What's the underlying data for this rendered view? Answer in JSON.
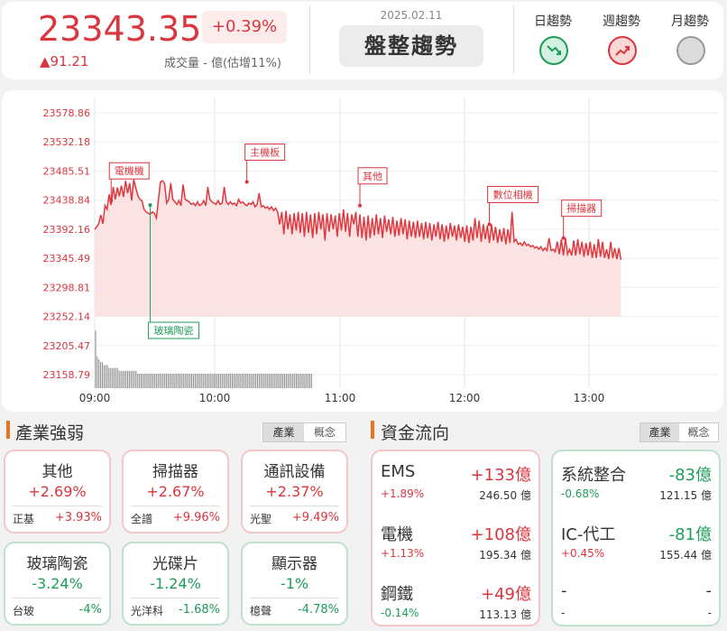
{
  "index": {
    "value": "23343.35",
    "change_pct": "+0.39%",
    "change": "▲91.21",
    "volume": "成交量 - 億(估增11%)",
    "date": "2025.02.11",
    "trend": "盤整趨勢"
  },
  "trends": [
    {
      "label": "日趨勢",
      "status": "down",
      "color": "#1e9c5a",
      "icon": "trend-down-icon"
    },
    {
      "label": "週趨勢",
      "status": "up",
      "color": "#d9363e",
      "icon": "trend-up-icon"
    },
    {
      "label": "月趨勢",
      "status": "neutral",
      "color": "#999999",
      "icon": "neutral-circle-icon"
    }
  ],
  "chart_data": {
    "type": "line",
    "y_ticks": [
      "23578.86",
      "23532.18",
      "23485.51",
      "23438.84",
      "23392.16",
      "23345.49",
      "23298.81",
      "23252.14",
      "23205.47",
      "23158.79"
    ],
    "x_ticks": [
      "09:00",
      "10:00",
      "11:00",
      "12:00",
      "13:00"
    ],
    "ylim": [
      23158.79,
      23578.86
    ],
    "xlim": [
      0,
      270
    ],
    "price": [
      [
        0,
        23392
      ],
      [
        1,
        23396
      ],
      [
        2,
        23402
      ],
      [
        3,
        23415
      ],
      [
        4,
        23401
      ],
      [
        5,
        23430
      ],
      [
        6,
        23424
      ],
      [
        7,
        23448
      ],
      [
        8,
        23431
      ],
      [
        9,
        23460
      ],
      [
        10,
        23440
      ],
      [
        11,
        23459
      ],
      [
        12,
        23445
      ],
      [
        13,
        23462
      ],
      [
        14,
        23444
      ],
      [
        15,
        23470
      ],
      [
        16,
        23450
      ],
      [
        17,
        23466
      ],
      [
        18,
        23438
      ],
      [
        19,
        23472
      ],
      [
        20,
        23458
      ],
      [
        21,
        23446
      ],
      [
        22,
        23440
      ],
      [
        23,
        23438
      ],
      [
        24,
        23424
      ],
      [
        25,
        23420
      ],
      [
        26,
        23418
      ],
      [
        27,
        23416
      ],
      [
        28,
        23420
      ],
      [
        29,
        23418
      ],
      [
        30,
        23410
      ],
      [
        31,
        23440
      ],
      [
        32,
        23468
      ],
      [
        33,
        23470
      ],
      [
        34,
        23465
      ],
      [
        35,
        23434
      ],
      [
        36,
        23440
      ],
      [
        37,
        23466
      ],
      [
        38,
        23440
      ],
      [
        39,
        23436
      ],
      [
        40,
        23432
      ],
      [
        41,
        23438
      ],
      [
        42,
        23430
      ],
      [
        43,
        23464
      ],
      [
        44,
        23440
      ],
      [
        45,
        23438
      ],
      [
        46,
        23436
      ],
      [
        47,
        23432
      ],
      [
        48,
        23434
      ],
      [
        49,
        23430
      ],
      [
        50,
        23436
      ],
      [
        51,
        23430
      ],
      [
        52,
        23432
      ],
      [
        53,
        23438
      ],
      [
        54,
        23430
      ],
      [
        55,
        23460
      ],
      [
        56,
        23440
      ],
      [
        57,
        23436
      ],
      [
        58,
        23434
      ],
      [
        59,
        23432
      ],
      [
        60,
        23438
      ],
      [
        61,
        23432
      ],
      [
        62,
        23434
      ],
      [
        63,
        23460
      ],
      [
        64,
        23436
      ],
      [
        65,
        23432
      ],
      [
        66,
        23436
      ],
      [
        67,
        23432
      ],
      [
        68,
        23434
      ],
      [
        69,
        23430
      ],
      [
        70,
        23440
      ],
      [
        71,
        23434
      ],
      [
        72,
        23436
      ],
      [
        73,
        23432
      ],
      [
        74,
        23430
      ],
      [
        75,
        23434
      ],
      [
        76,
        23432
      ],
      [
        77,
        23436
      ],
      [
        78,
        23428
      ],
      [
        79,
        23432
      ],
      [
        80,
        23450
      ],
      [
        81,
        23428
      ],
      [
        82,
        23430
      ],
      [
        83,
        23426
      ],
      [
        84,
        23428
      ],
      [
        85,
        23424
      ],
      [
        86,
        23428
      ],
      [
        87,
        23422
      ],
      [
        88,
        23426
      ],
      [
        89,
        23420
      ],
      [
        90,
        23400
      ],
      [
        91,
        23420
      ],
      [
        92,
        23384
      ],
      [
        93,
        23422
      ],
      [
        94,
        23392
      ],
      [
        95,
        23416
      ],
      [
        96,
        23384
      ],
      [
        97,
        23418
      ],
      [
        98,
        23390
      ],
      [
        99,
        23420
      ],
      [
        100,
        23386
      ],
      [
        101,
        23418
      ],
      [
        102,
        23380
      ],
      [
        103,
        23420
      ],
      [
        104,
        23386
      ],
      [
        105,
        23416
      ],
      [
        106,
        23378
      ],
      [
        107,
        23418
      ],
      [
        108,
        23384
      ],
      [
        109,
        23420
      ],
      [
        110,
        23392
      ],
      [
        111,
        23416
      ],
      [
        112,
        23374
      ],
      [
        113,
        23418
      ],
      [
        114,
        23388
      ],
      [
        115,
        23416
      ],
      [
        116,
        23392
      ],
      [
        117,
        23414
      ],
      [
        118,
        23380
      ],
      [
        119,
        23418
      ],
      [
        120,
        23390
      ],
      [
        121,
        23424
      ],
      [
        122,
        23388
      ],
      [
        123,
        23418
      ],
      [
        124,
        23380
      ],
      [
        125,
        23416
      ],
      [
        126,
        23400
      ],
      [
        127,
        23420
      ],
      [
        128,
        23380
      ],
      [
        129,
        23416
      ],
      [
        130,
        23378
      ],
      [
        131,
        23412
      ],
      [
        132,
        23374
      ],
      [
        133,
        23414
      ],
      [
        134,
        23378
      ],
      [
        135,
        23410
      ],
      [
        136,
        23382
      ],
      [
        137,
        23416
      ],
      [
        138,
        23384
      ],
      [
        139,
        23410
      ],
      [
        140,
        23378
      ],
      [
        141,
        23414
      ],
      [
        142,
        23388
      ],
      [
        143,
        23408
      ],
      [
        144,
        23384
      ],
      [
        145,
        23412
      ],
      [
        146,
        23380
      ],
      [
        147,
        23406
      ],
      [
        148,
        23382
      ],
      [
        149,
        23410
      ],
      [
        150,
        23384
      ],
      [
        151,
        23408
      ],
      [
        152,
        23376
      ],
      [
        153,
        23406
      ],
      [
        154,
        23380
      ],
      [
        155,
        23404
      ],
      [
        156,
        23378
      ],
      [
        157,
        23406
      ],
      [
        158,
        23380
      ],
      [
        159,
        23402
      ],
      [
        160,
        23376
      ],
      [
        161,
        23404
      ],
      [
        162,
        23378
      ],
      [
        163,
        23402
      ],
      [
        164,
        23374
      ],
      [
        165,
        23400
      ],
      [
        166,
        23380
      ],
      [
        167,
        23404
      ],
      [
        168,
        23376
      ],
      [
        169,
        23400
      ],
      [
        170,
        23372
      ],
      [
        171,
        23398
      ],
      [
        172,
        23376
      ],
      [
        173,
        23402
      ],
      [
        174,
        23380
      ],
      [
        175,
        23398
      ],
      [
        176,
        23374
      ],
      [
        177,
        23400
      ],
      [
        178,
        23378
      ],
      [
        179,
        23396
      ],
      [
        180,
        23372
      ],
      [
        181,
        23398
      ],
      [
        182,
        23370
      ],
      [
        183,
        23396
      ],
      [
        184,
        23374
      ],
      [
        185,
        23410
      ],
      [
        186,
        23378
      ],
      [
        187,
        23406
      ],
      [
        188,
        23372
      ],
      [
        189,
        23400
      ],
      [
        190,
        23376
      ],
      [
        191,
        23398
      ],
      [
        192,
        23370
      ],
      [
        193,
        23400
      ],
      [
        194,
        23374
      ],
      [
        195,
        23396
      ],
      [
        196,
        23370
      ],
      [
        197,
        23392
      ],
      [
        198,
        23372
      ],
      [
        199,
        23394
      ],
      [
        200,
        23368
      ],
      [
        201,
        23392
      ],
      [
        202,
        23370
      ],
      [
        203,
        23420
      ],
      [
        204,
        23372
      ],
      [
        205,
        23376
      ],
      [
        206,
        23368
      ],
      [
        207,
        23370
      ],
      [
        208,
        23366
      ],
      [
        209,
        23372
      ],
      [
        210,
        23366
      ],
      [
        211,
        23368
      ],
      [
        212,
        23364
      ],
      [
        213,
        23366
      ],
      [
        214,
        23362
      ],
      [
        215,
        23364
      ],
      [
        216,
        23360
      ],
      [
        217,
        23364
      ],
      [
        218,
        23358
      ],
      [
        219,
        23362
      ],
      [
        220,
        23358
      ],
      [
        221,
        23378
      ],
      [
        222,
        23358
      ],
      [
        223,
        23360
      ],
      [
        224,
        23356
      ],
      [
        225,
        23372
      ],
      [
        226,
        23352
      ],
      [
        227,
        23376
      ],
      [
        228,
        23350
      ],
      [
        229,
        23378
      ],
      [
        230,
        23352
      ],
      [
        231,
        23360
      ],
      [
        232,
        23350
      ],
      [
        233,
        23374
      ],
      [
        234,
        23350
      ],
      [
        235,
        23376
      ],
      [
        236,
        23352
      ],
      [
        237,
        23372
      ],
      [
        238,
        23348
      ],
      [
        239,
        23370
      ],
      [
        240,
        23350
      ],
      [
        241,
        23372
      ],
      [
        242,
        23346
      ],
      [
        243,
        23368
      ],
      [
        244,
        23346
      ],
      [
        245,
        23376
      ],
      [
        246,
        23348
      ],
      [
        247,
        23372
      ],
      [
        248,
        23346
      ],
      [
        249,
        23360
      ],
      [
        250,
        23344
      ],
      [
        251,
        23372
      ],
      [
        252,
        23346
      ],
      [
        253,
        23362
      ],
      [
        254,
        23344
      ],
      [
        255,
        23362
      ],
      [
        256,
        23343
      ]
    ],
    "volume": [
      20,
      11,
      10,
      9,
      9,
      8,
      8,
      8,
      7,
      7,
      7,
      7,
      7,
      7,
      6,
      6,
      6,
      6,
      6,
      6,
      6,
      6,
      6,
      6,
      6,
      5,
      5,
      5,
      5,
      5,
      5,
      5,
      5,
      5,
      5,
      5,
      5,
      5,
      5,
      5,
      5,
      5,
      5,
      5,
      5,
      5,
      5,
      5,
      5,
      5,
      5,
      5,
      5,
      5,
      5,
      5,
      5,
      5,
      5,
      5,
      5,
      5,
      5,
      5,
      5,
      5,
      5,
      5,
      5,
      5,
      5,
      5,
      5,
      5,
      5,
      5,
      5,
      5,
      5,
      5,
      5,
      5,
      5,
      5,
      5,
      5,
      5,
      5,
      5,
      5,
      5,
      5,
      5,
      5,
      5,
      5,
      5,
      5,
      5,
      5,
      5,
      5,
      5,
      5,
      5,
      5,
      5,
      5,
      5,
      5,
      5,
      5,
      5,
      5,
      5,
      5,
      5,
      5,
      5,
      5,
      5,
      5,
      5,
      5,
      5,
      5,
      5,
      5,
      5
    ],
    "annotations": [
      {
        "label": "電機機",
        "t": 8,
        "price": 23438,
        "dir": "up"
      },
      {
        "label": "玻璃陶瓷",
        "t": 27,
        "price": 23431,
        "dir": "down"
      },
      {
        "label": "主機板",
        "t": 74,
        "price": 23468,
        "dir": "up"
      },
      {
        "label": "其他",
        "t": 129,
        "price": 23430,
        "dir": "up"
      },
      {
        "label": "數位相機",
        "t": 192,
        "price": 23400,
        "dir": "up"
      },
      {
        "label": "掃描器",
        "t": 228,
        "price": 23378,
        "dir": "up"
      }
    ]
  },
  "industry": {
    "title": "產業強弱",
    "seg": [
      "產業",
      "概念"
    ],
    "cards": [
      {
        "name": "其他",
        "pct": "+2.69%",
        "stock": "正基",
        "stock_pct": "+3.93%",
        "dir": "up"
      },
      {
        "name": "掃描器",
        "pct": "+2.67%",
        "stock": "全譜",
        "stock_pct": "+9.96%",
        "dir": "up"
      },
      {
        "name": "通訊設備",
        "pct": "+2.37%",
        "stock": "光聖",
        "stock_pct": "+9.49%",
        "dir": "up"
      },
      {
        "name": "玻璃陶瓷",
        "pct": "-3.24%",
        "stock": "台玻",
        "stock_pct": "-4%",
        "dir": "down"
      },
      {
        "name": "光碟片",
        "pct": "-1.24%",
        "stock": "光洋科",
        "stock_pct": "-1.68%",
        "dir": "down"
      },
      {
        "name": "顯示器",
        "pct": "-1%",
        "stock": "檍聲",
        "stock_pct": "-4.78%",
        "dir": "down"
      }
    ]
  },
  "flow": {
    "title": "資金流向",
    "seg": [
      "產業",
      "概念"
    ],
    "in": [
      {
        "name": "EMS",
        "amount": "+133億",
        "pct": "+1.89%",
        "total": "246.50 億"
      },
      {
        "name": "電機",
        "amount": "+108億",
        "pct": "+1.13%",
        "total": "195.34 億"
      },
      {
        "name": "鋼鐵",
        "amount": "+49億",
        "pct": "-0.14%",
        "total": "113.13 億"
      }
    ],
    "out": [
      {
        "name": "系統整合",
        "amount": "-83億",
        "pct": "-0.68%",
        "total": "121.15 億"
      },
      {
        "name": "IC-代工",
        "amount": "-81億",
        "pct": "+0.45%",
        "total": "155.44 億"
      },
      {
        "name": "-",
        "amount": "-",
        "pct": "-",
        "total": "-"
      }
    ]
  }
}
